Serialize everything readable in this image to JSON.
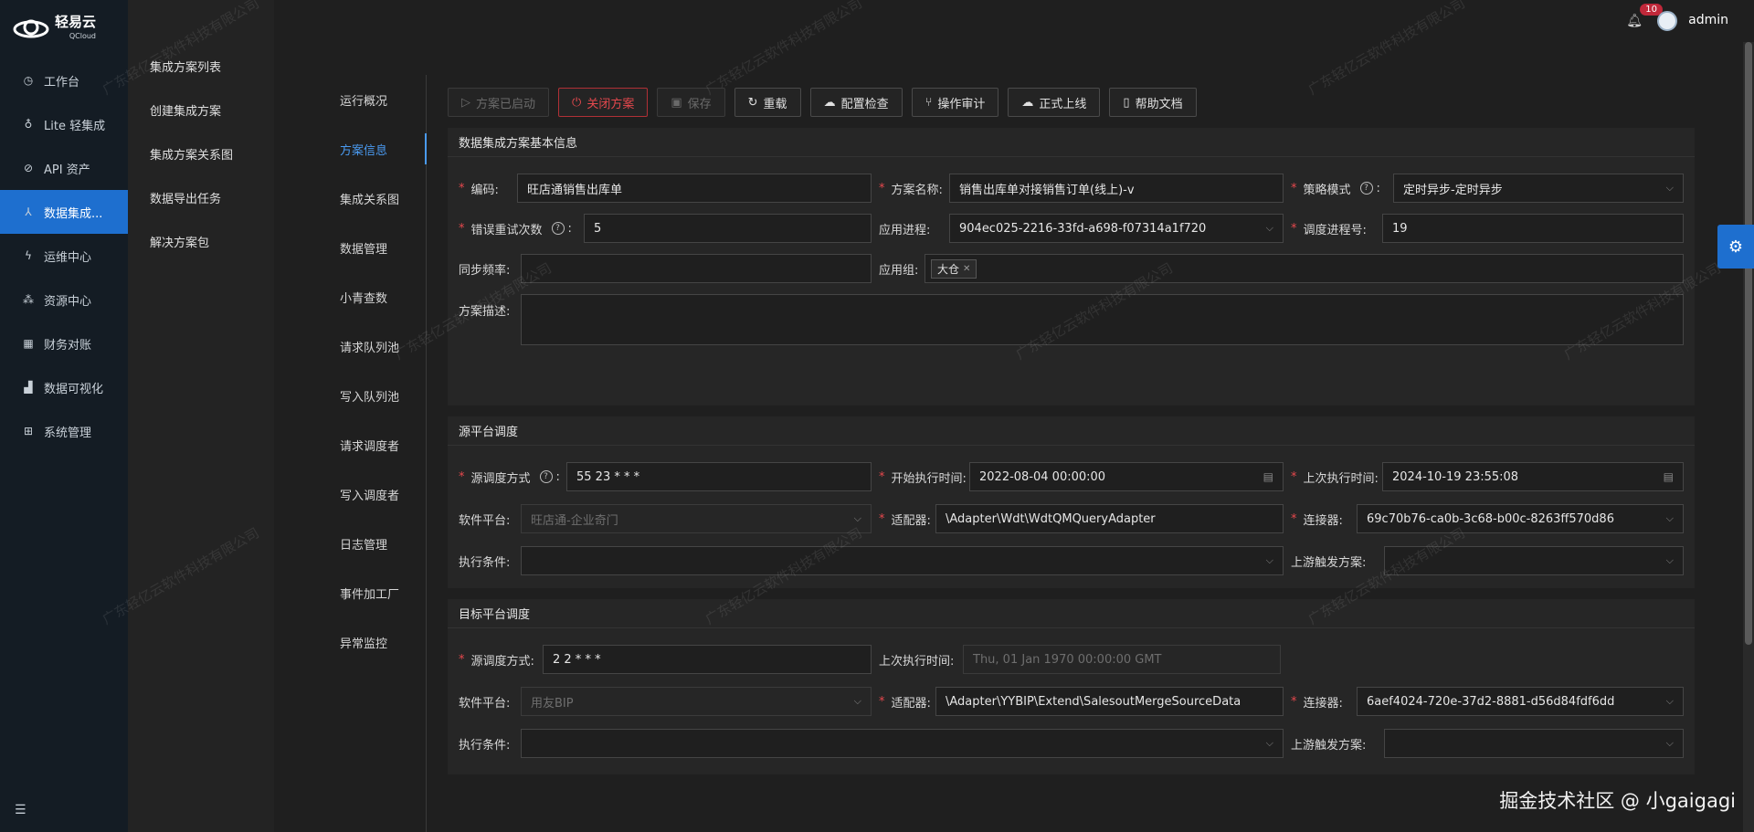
{
  "app": {
    "brand": "轻易云",
    "brand_sub": "QCloud",
    "user": "admin",
    "notification_count": "10"
  },
  "leftnav": {
    "items": [
      {
        "label": "工作台",
        "icon": "clock-icon"
      },
      {
        "label": "Lite 轻集成",
        "icon": "bulb-icon"
      },
      {
        "label": "API 资产",
        "icon": "compass-icon"
      },
      {
        "label": "数据集成...",
        "icon": "network-icon"
      },
      {
        "label": "运维中心",
        "icon": "bolt-icon"
      },
      {
        "label": "资源中心",
        "icon": "cluster-icon"
      },
      {
        "label": "财务对账",
        "icon": "calculator-icon"
      },
      {
        "label": "数据可视化",
        "icon": "chart-icon"
      },
      {
        "label": "系统管理",
        "icon": "grid-icon"
      }
    ]
  },
  "submenu": {
    "items": [
      "集成方案列表",
      "创建集成方案",
      "集成方案关系图",
      "数据导出任务",
      "解决方案包"
    ]
  },
  "tabs": {
    "items": [
      "运行概况",
      "方案信息",
      "集成关系图",
      "数据管理",
      "小青查数",
      "请求队列池",
      "写入队列池",
      "请求调度者",
      "写入调度者",
      "日志管理",
      "事件加工厂",
      "异常监控"
    ]
  },
  "toolbar": {
    "started": "方案已启动",
    "close": "关闭方案",
    "save": "保存",
    "reload": "重载",
    "check": "配置检查",
    "audit": "操作审计",
    "publish": "正式上线",
    "help": "帮助文档"
  },
  "basic": {
    "title": "数据集成方案基本信息",
    "code_label": "编码:",
    "code_value": "旺店通销售出库单",
    "name_label": "方案名称:",
    "name_value": "销售出库单对接销售订单(线上)-v",
    "strategy_label": "策略模式",
    "strategy_value": "定时异步-定时异步",
    "retry_label": "错误重试次数",
    "retry_value": "5",
    "process_label": "应用进程:",
    "process_value": "904ec025-2216-33fd-a698-f07314a1f720",
    "sched_label": "调度进程号:",
    "sched_value": "19",
    "freq_label": "同步频率:",
    "freq_value": "",
    "group_label": "应用组:",
    "group_tag": "大仓",
    "desc_label": "方案描述:",
    "desc_value": ""
  },
  "source": {
    "title": "源平台调度",
    "mode_label": "源调度方式",
    "mode_value": "55 23 * * *",
    "start_label": "开始执行时间:",
    "start_value": "2022-08-04 00:00:00",
    "last_label": "上次执行时间:",
    "last_value": "2024-10-19 23:55:08",
    "platform_label": "软件平台:",
    "platform_value": "旺店通-企业奇门",
    "adapter_label": "适配器:",
    "adapter_value": "\\Adapter\\Wdt\\WdtQMQueryAdapter",
    "connector_label": "连接器:",
    "connector_value": "69c70b76-ca0b-3c68-b00c-8263ff570d86",
    "cond_label": "执行条件:",
    "cond_value": "",
    "upstream_label": "上游触发方案:",
    "upstream_value": ""
  },
  "target": {
    "title": "目标平台调度",
    "mode_label": "源调度方式:",
    "mode_value": "2 2 * * *",
    "last_label": "上次执行时间:",
    "last_value": "Thu, 01 Jan 1970 00:00:00 GMT",
    "platform_label": "软件平台:",
    "platform_value": "用友BIP",
    "adapter_label": "适配器:",
    "adapter_value": "\\Adapter\\YYBIP\\Extend\\SalesoutMergeSourceData",
    "connector_label": "连接器:",
    "connector_value": "6aef4024-720e-37d2-8881-d56d84fdf6dd",
    "cond_label": "执行条件:",
    "cond_value": "",
    "upstream_label": "上游触发方案:",
    "upstream_value": ""
  },
  "watermark": "广东轻亿云软件科技有限公司",
  "footer_mark": "掘金技术社区 @ 小gaigagi"
}
